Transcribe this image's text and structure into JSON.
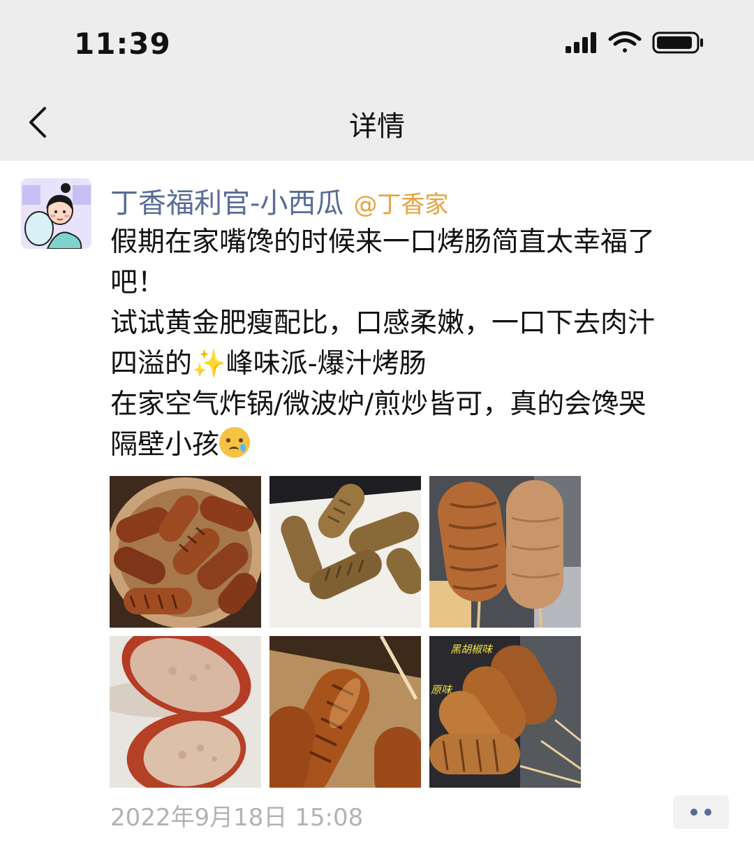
{
  "status_bar": {
    "time": "11:39",
    "icons": [
      "signal-icon",
      "wifi-icon",
      "battery-icon"
    ]
  },
  "nav": {
    "title": "详情",
    "back_icon": "chevron-left-icon"
  },
  "post": {
    "author": "丁香福利官-小西瓜",
    "handle": "@丁香家",
    "lines": [
      "假期在家嘴馋的时候来一口烤肠简直太幸福了",
      "吧！",
      "试试黄金肥瘦配比，口感柔嫩，一口下去肉汁",
      "四溢的",
      "峰味派-爆汁烤肠",
      "在家空气炸锅/微波炉/煎炒皆可，真的会馋哭",
      "隔壁小孩"
    ],
    "emoji_sparkle": "✨",
    "photos": [
      "sausages-air-fryer-photo",
      "sausages-plate-photo",
      "sausages-skewer-photo",
      "sausage-cross-section-photo",
      "grilled-sausage-closeup-photo",
      "flavored-sausages-photo"
    ],
    "photo_labels": {
      "black_pepper": "黑胡椒味",
      "original": "原味"
    },
    "timestamp": "2022年9月18日 15:08",
    "more_icon": "more-dots-icon"
  },
  "colors": {
    "header_bg": "#ededed",
    "author_name": "#576b95",
    "handle": "#e7a23f",
    "timestamp": "#b2b2b2"
  }
}
